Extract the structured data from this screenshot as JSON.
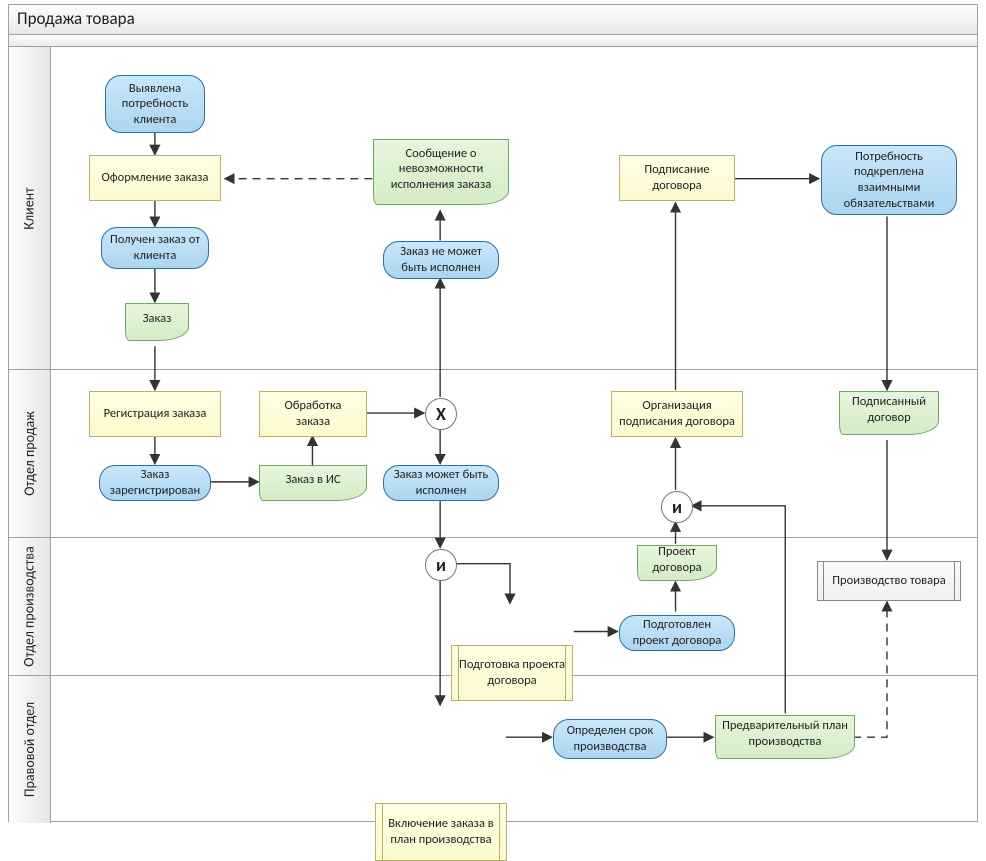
{
  "title": "Продажа товара",
  "lanes": {
    "l1": "Клиент",
    "l2": "Отдел продаж",
    "l3": "Отдел производства",
    "l4": "Правовой отдел"
  },
  "gateways": {
    "xor": "X",
    "and": "и"
  },
  "nodes": {
    "start": "Выявлена потребность клиента",
    "order": "Оформление заказа",
    "msg_impos": "Сообщение о невозможности исполнения заказа",
    "sign": "Подписание договора",
    "need_backed": "Потребность подкреплена взаимными обязательствами",
    "got_order": "Получен заказ от клиента",
    "cannot": "Заказ не может быть исполнен",
    "doc_order": "Заказ",
    "reg": "Регистрация заказа",
    "proc": "Обработка заказа",
    "org_sign": "Организация подписания договора",
    "signed_doc": "Подписанный договор",
    "registered": "Заказ зарегистрирован",
    "order_is": "Заказ в ИС",
    "can_exec": "Заказ может быть исполнен",
    "proj_doc": "Проект договора",
    "manuf": "Производство товара",
    "prep_proj": "Подготовка проекта договора",
    "proj_ready": "Подготовлен проект договора",
    "incl_plan": "Включение заказа в план производства",
    "deadline": "Определен срок производства",
    "pre_plan": "Предварительный план производства"
  }
}
